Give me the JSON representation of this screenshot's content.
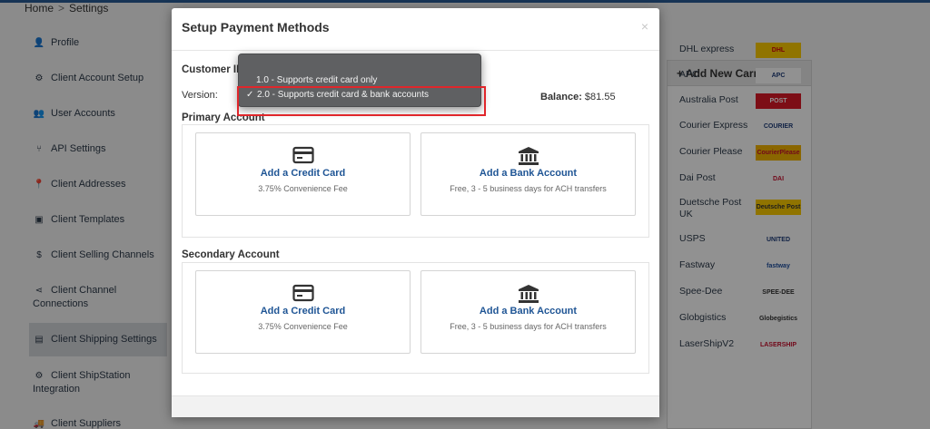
{
  "breadcrumb": {
    "home": "Home",
    "separator": ">",
    "current": "Settings"
  },
  "sidebar": {
    "items": [
      {
        "label": "Profile",
        "icon": "user-icon",
        "glyph": "👤"
      },
      {
        "label": "Client Account Setup",
        "icon": "gear-icon",
        "glyph": "⚙"
      },
      {
        "label": "User Accounts",
        "icon": "users-icon",
        "glyph": "👥"
      },
      {
        "label": "API Settings",
        "icon": "plug-icon",
        "glyph": "⑂"
      },
      {
        "label": "Client Addresses",
        "icon": "map-pin-icon",
        "glyph": "📍"
      },
      {
        "label": "Client Templates",
        "icon": "image-icon",
        "glyph": "▣"
      },
      {
        "label": "Client Selling Channels",
        "icon": "dollar-icon",
        "glyph": "$"
      },
      {
        "label": "Client Channel Connections",
        "icon": "share-icon",
        "glyph": "⋖"
      },
      {
        "label": "Client Shipping Settings",
        "icon": "document-icon",
        "glyph": "▤",
        "active": true
      },
      {
        "label": "Client ShipStation Integration",
        "icon": "gear-icon",
        "glyph": "⚙"
      },
      {
        "label": "Client Suppliers",
        "icon": "truck-icon",
        "glyph": "🚚"
      }
    ]
  },
  "carriers": {
    "header": "+ Add New Carrier",
    "items": [
      {
        "name": "DHL express",
        "logo_text": "DHL",
        "logo_bg": "#fecc00",
        "logo_color": "#d40511"
      },
      {
        "name": "APC",
        "logo_text": "APC",
        "logo_bg": "#ffffff",
        "logo_color": "#1f3d7a"
      },
      {
        "name": "Australia Post",
        "logo_text": "POST",
        "logo_bg": "#dc1928",
        "logo_color": "#ffffff"
      },
      {
        "name": "Courier Express",
        "logo_text": "COURIER EXPRESS",
        "logo_bg": "#ffffff",
        "logo_color": "#1f3d7a"
      },
      {
        "name": "Courier Please",
        "logo_text": "CourierPlease",
        "logo_bg": "#f3b300",
        "logo_color": "#c8102e"
      },
      {
        "name": "Dai Post",
        "logo_text": "DAI",
        "logo_bg": "#ffffff",
        "logo_color": "#c8102e"
      },
      {
        "name": "Duetsche Post UK",
        "logo_text": "Deutsche Post",
        "logo_bg": "#fecc00",
        "logo_color": "#333333"
      },
      {
        "name": "USPS",
        "logo_text": "UNITED STATES POSTAL SERVICE",
        "logo_bg": "#ffffff",
        "logo_color": "#1f3d7a"
      },
      {
        "name": "Fastway",
        "logo_text": "fastway",
        "logo_bg": "#ffffff",
        "logo_color": "#1f4fa0"
      },
      {
        "name": "Spee-Dee",
        "logo_text": "SPEE-DEE",
        "logo_bg": "#ffffff",
        "logo_color": "#333333"
      },
      {
        "name": "Globgistics",
        "logo_text": "Globegistics",
        "logo_bg": "#ffffff",
        "logo_color": "#333333"
      },
      {
        "name": "LaserShipV2",
        "logo_text": "LASERSHIP",
        "logo_bg": "#ffffff",
        "logo_color": "#c8102e"
      }
    ]
  },
  "modal": {
    "title": "Setup Payment Methods",
    "close": "×",
    "customer_id_label": "Customer ID",
    "version_label": "Version:",
    "balance_label": "Balance:",
    "balance_value": "$81.55",
    "primary": {
      "title": "Primary Account",
      "credit": {
        "title": "Add a Credit Card",
        "sub": "3.75% Convenience Fee"
      },
      "bank": {
        "title": "Add a Bank Account",
        "sub": "Free, 3 - 5 business days for ACH transfers"
      }
    },
    "secondary": {
      "title": "Secondary Account",
      "credit": {
        "title": "Add a Credit Card",
        "sub": "3.75% Convenience Fee"
      },
      "bank": {
        "title": "Add a Bank Account",
        "sub": "Free, 3 - 5 business days for ACH transfers"
      }
    }
  },
  "version_dropdown": {
    "options": [
      {
        "label": "1.0 - Supports credit card only",
        "selected": false
      },
      {
        "label": "2.0 - Supports credit card & bank accounts",
        "selected": true
      }
    ],
    "check_glyph": "✓"
  },
  "colors": {
    "accent_blue": "#1f5595",
    "highlight_red": "#e0262b",
    "top_stripe": "#2a5c96"
  }
}
